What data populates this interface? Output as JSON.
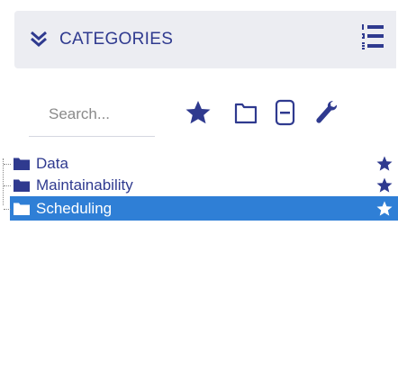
{
  "header": {
    "title": "CATEGORIES",
    "collapse_icon": "chevron-double-down-icon",
    "menu_icon": "list-numbered-icon"
  },
  "toolbar": {
    "search_placeholder": "Search...",
    "favorites_icon": "star-icon",
    "expand_icon": "folder-outline-icon",
    "collapse_all_icon": "collapse-all-icon",
    "settings_icon": "wrench-icon"
  },
  "tree": {
    "items": [
      {
        "label": "Data",
        "icon": "folder-icon",
        "favorite_icon": "star-icon",
        "selected": false
      },
      {
        "label": "Maintainability",
        "icon": "folder-icon",
        "favorite_icon": "star-icon",
        "selected": false
      },
      {
        "label": "Scheduling",
        "icon": "folder-icon",
        "favorite_icon": "star-icon",
        "selected": true
      }
    ]
  },
  "colors": {
    "accent": "#2f3a8f",
    "header_bg": "#ecedf2",
    "selection": "#2f7fd6"
  }
}
